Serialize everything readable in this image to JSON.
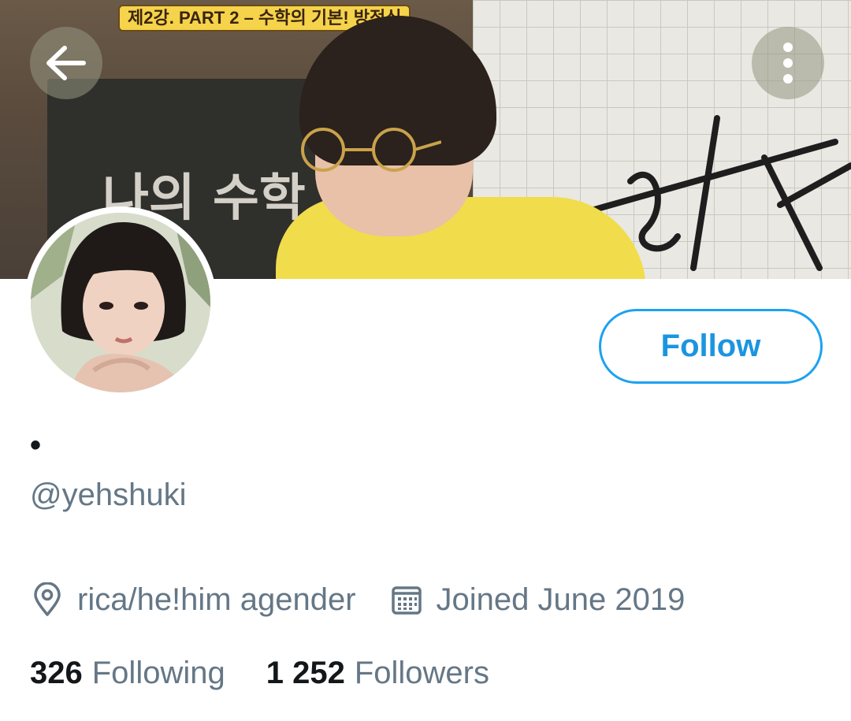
{
  "banner": {
    "caption": "제2강. PART 2 – 수학의 기본! 방정식",
    "board_text": "나의 수학"
  },
  "header": {
    "back_icon": "arrow-left-icon",
    "more_icon": "more-vertical-icon"
  },
  "profile": {
    "display_name": "•",
    "handle": "@yehshuki",
    "follow_label": "Follow",
    "location": "rica/he!him agender",
    "joined": "Joined June 2019",
    "following_count": "326",
    "following_label": "Following",
    "followers_count": "1 252",
    "followers_label": "Followers"
  },
  "colors": {
    "accent": "#1da1f2",
    "secondary_text": "#657786",
    "primary_text": "#14171a"
  }
}
